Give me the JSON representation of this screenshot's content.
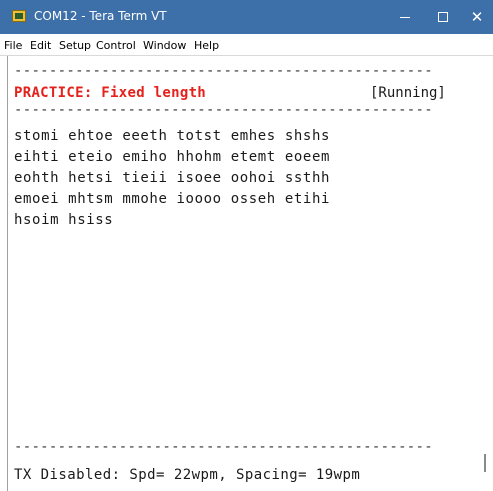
{
  "window": {
    "title": "COM12 - Tera Term VT",
    "controls": {
      "minimize_icon": "minimize-icon",
      "maximize_icon": "maximize-icon",
      "close_icon": "close-icon",
      "close_glyph": "✕"
    },
    "titlebar_color": "#3d6fa8"
  },
  "menu": {
    "items": [
      "File",
      "Edit",
      "Setup",
      "Control",
      "Window",
      "Help"
    ]
  },
  "terminal": {
    "divider_top": "------------------------------------------------",
    "heading": "PRACTICE: Fixed length",
    "status": "[Running]",
    "divider_mid": "------------------------------------------------",
    "lines": [
      "stomi ehtoe eeeth totst emhes shshs",
      "eihti eteio emiho hhohm etemt eoeem",
      "eohth hetsi tieii isoee oohoi ssthh",
      "emoei mhtsm mmohe ioooo osseh etihi",
      "hsoim hsiss"
    ],
    "divider_bottom": "------------------------------------------------",
    "footer": "TX Disabled: Spd= 22wpm, Spacing= 19wpm",
    "heading_color": "#e5211b"
  }
}
